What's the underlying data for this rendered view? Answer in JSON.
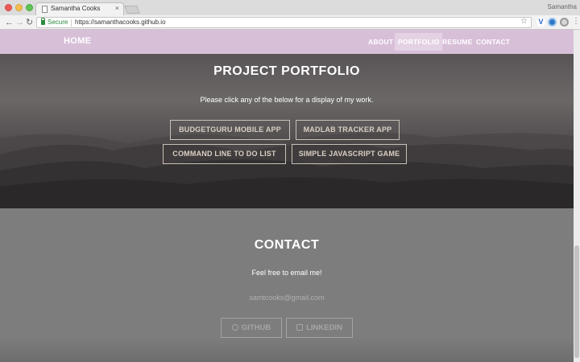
{
  "browser": {
    "tab_title": "Samantha Cooks",
    "tab_close": "×",
    "profile_name": "Samantha",
    "back_icon": "←",
    "forward_icon": "→",
    "reload_icon": "↻",
    "secure_label": "Secure",
    "url": "https://samanthacooks.github.io",
    "star_icon": "☆",
    "menu_icon": "⋮",
    "ext_a_glyph": "V"
  },
  "site_nav": {
    "brand": "HOME",
    "items": [
      {
        "label": "ABOUT",
        "active": false
      },
      {
        "label": "PORTFOLIO",
        "active": true
      },
      {
        "label": "RESUME",
        "active": false
      },
      {
        "label": "CONTACT",
        "active": false
      }
    ]
  },
  "portfolio": {
    "title": "PROJECT PORTFOLIO",
    "subtitle": "Please click any of the below for a display of my work.",
    "projects": [
      {
        "label": "BUDGETGURU MOBILE APP"
      },
      {
        "label": "MADLAB TRACKER APP"
      },
      {
        "label": "COMMAND LINE TO DO LIST"
      },
      {
        "label": "SIMPLE JAVASCRIPT GAME"
      }
    ]
  },
  "contact": {
    "title": "CONTACT",
    "subtitle": "Feel free to email me!",
    "email": "samtcooks@gmail.com",
    "github_label": "GITHUB",
    "linkedin_label": "LINKEDIN"
  },
  "colors": {
    "nav_bg": "#d8bfd8",
    "nav_active_bg": "#e4d2e4",
    "contact_bg": "#7d7d7d",
    "button_border": "#c8c1b8"
  }
}
